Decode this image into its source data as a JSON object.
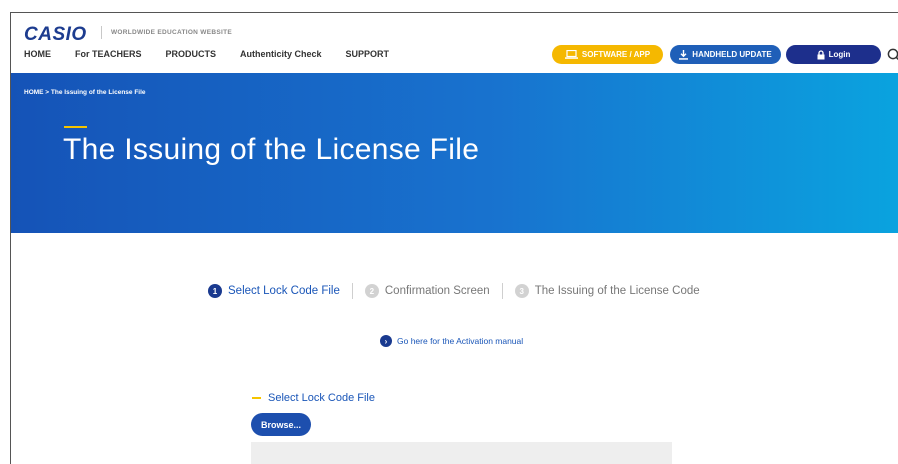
{
  "header": {
    "logo": "CASIO",
    "tagline": "WORLDWIDE EDUCATION WEBSITE",
    "nav": [
      "HOME",
      "For TEACHERS",
      "PRODUCTS",
      "Authenticity Check",
      "SUPPORT"
    ],
    "software_label": "SOFTWARE / APP",
    "handheld_label": "HANDHELD UPDATE",
    "login_label": "Login"
  },
  "hero": {
    "breadcrumb": "HOME > The Issuing of the License File",
    "title": "The Issuing of the License File"
  },
  "steps": [
    {
      "num": "1",
      "label": "Select Lock Code File",
      "state": "active"
    },
    {
      "num": "2",
      "label": "Confirmation Screen",
      "state": "inactive"
    },
    {
      "num": "3",
      "label": "The Issuing of the License Code",
      "state": "inactive"
    }
  ],
  "manual_link": {
    "icon": "›",
    "label": "Go here for the Activation manual"
  },
  "upload": {
    "section_title": "Select Lock Code File",
    "browse_label": "Browse..."
  },
  "colors": {
    "brand": "#1d3c8f",
    "accent_yellow": "#f5b800",
    "link_blue": "#1a56b8",
    "hero_gradient_start": "#1553b7",
    "hero_gradient_end": "#0aa3df"
  }
}
